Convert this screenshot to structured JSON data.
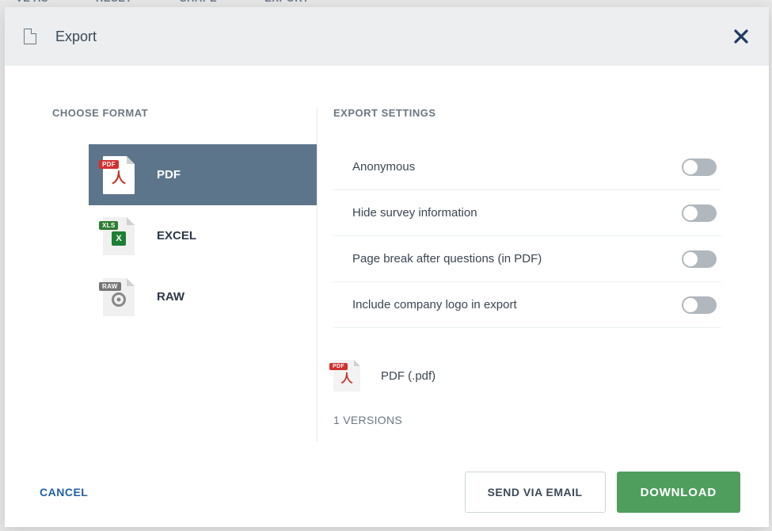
{
  "bg_menu": {
    "save_as": "VE AS",
    "reset": "RESET",
    "shape": "SHAPE",
    "export": "EXPORT"
  },
  "modal": {
    "title": "Export",
    "choose_format_heading": "CHOOSE FORMAT",
    "export_settings_heading": "EXPORT SETTINGS",
    "formats": [
      {
        "label": "PDF",
        "badge": "PDF",
        "active": true
      },
      {
        "label": "EXCEL",
        "badge": "XLS",
        "active": false
      },
      {
        "label": "RAW",
        "badge": "RAW",
        "active": false
      }
    ],
    "settings": [
      {
        "label": "Anonymous",
        "on": false
      },
      {
        "label": "Hide survey information",
        "on": false
      },
      {
        "label": "Page break after questions (in PDF)",
        "on": false
      },
      {
        "label": "Include company logo in export",
        "on": false
      }
    ],
    "selected_file_label": "PDF (.pdf)",
    "versions_label": "1 VERSIONS",
    "footer": {
      "cancel": "CANCEL",
      "send_email": "SEND VIA EMAIL",
      "download": "DOWNLOAD"
    }
  }
}
